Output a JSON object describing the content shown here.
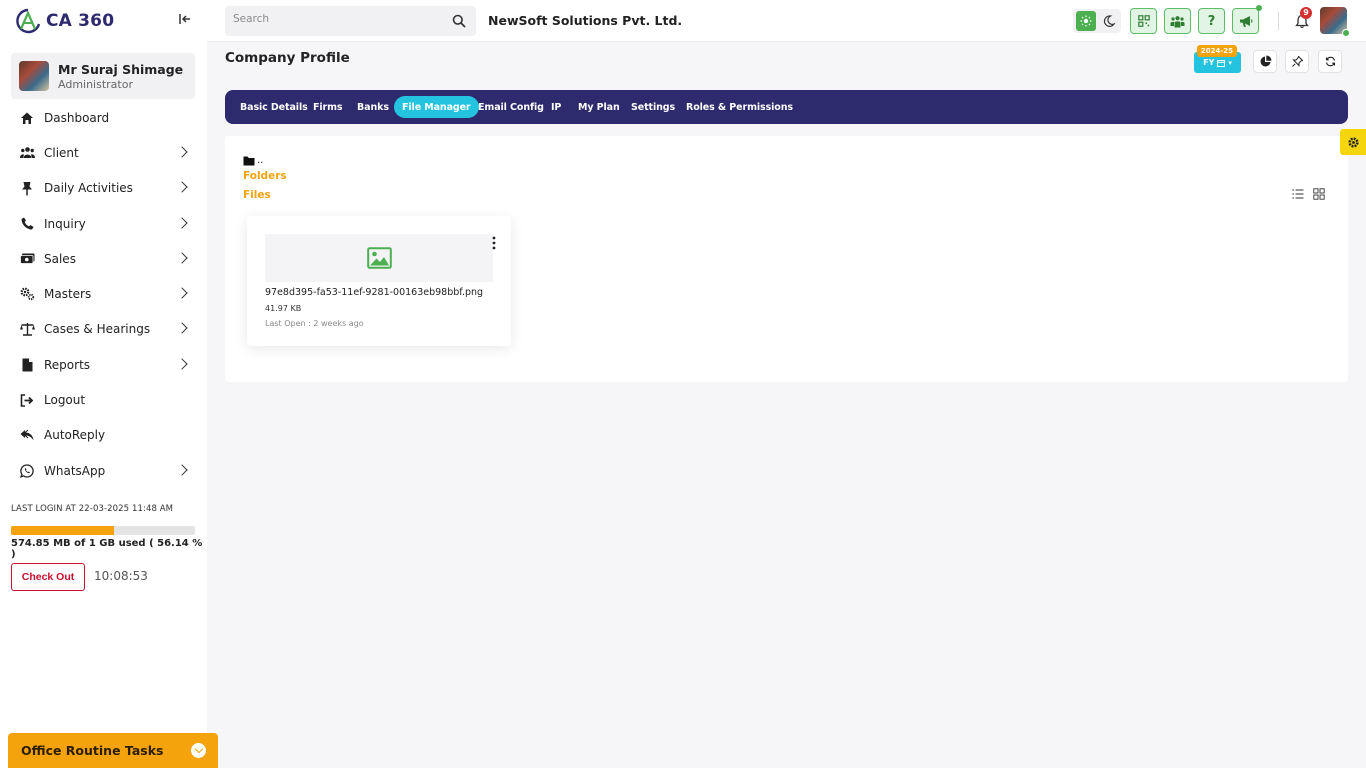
{
  "app": {
    "logo_text": "CA 360",
    "accent": "#2d2a6e",
    "highlight": "#24c4e0",
    "orange": "#f4a30c"
  },
  "user": {
    "name": "Mr Suraj Shimage",
    "role": "Administrator"
  },
  "sidebar": {
    "items": [
      {
        "label": "Dashboard",
        "icon": "home-icon",
        "has_chevron": false
      },
      {
        "label": "Client",
        "icon": "users-icon",
        "has_chevron": true
      },
      {
        "label": "Daily Activities",
        "icon": "pin-icon",
        "has_chevron": true
      },
      {
        "label": "Inquiry",
        "icon": "phone-icon",
        "has_chevron": true
      },
      {
        "label": "Sales",
        "icon": "money-icon",
        "has_chevron": true
      },
      {
        "label": "Masters",
        "icon": "gears-icon",
        "has_chevron": true
      },
      {
        "label": "Cases & Hearings",
        "icon": "scale-icon",
        "has_chevron": true
      },
      {
        "label": "Reports",
        "icon": "file-icon",
        "has_chevron": true
      },
      {
        "label": "Logout",
        "icon": "logout-icon",
        "has_chevron": false
      },
      {
        "label": "AutoReply",
        "icon": "reply-icon",
        "has_chevron": false
      },
      {
        "label": "WhatsApp",
        "icon": "whatsapp-icon",
        "has_chevron": true
      }
    ],
    "last_login": "LAST LOGIN AT 22-03-2025 11:48 AM",
    "storage_text": "574.85 MB of 1 GB used ( 56.14 % )",
    "storage_fraction": 0.5614,
    "checkout_label": "Check Out",
    "clock": "10:08:53",
    "routine_label": "Office Routine Tasks"
  },
  "header": {
    "search_placeholder": "Search",
    "company": "NewSoft Solutions Pvt. Ltd.",
    "notification_count": "9"
  },
  "page": {
    "title": "Company Profile",
    "fy_label": "FY",
    "fy_year": "2024-25",
    "tabs": [
      {
        "label": "Basic Details",
        "active": false
      },
      {
        "label": "Firms",
        "active": false
      },
      {
        "label": "Banks",
        "active": false
      },
      {
        "label": "File Manager",
        "active": true
      },
      {
        "label": "Email Config",
        "active": false
      },
      {
        "label": "IP",
        "active": false
      },
      {
        "label": "My Plan",
        "active": false
      },
      {
        "label": "Settings",
        "active": false
      },
      {
        "label": "Roles & Permissions",
        "active": false
      }
    ]
  },
  "file_manager": {
    "crumb": "..",
    "folders_label": "Folders",
    "files_label": "Files",
    "files": [
      {
        "name": "97e8d395-fa53-11ef-9281-00163eb98bbf.png",
        "size": "41.97 KB",
        "last_open": "Last Open : 2 weeks ago"
      }
    ]
  }
}
